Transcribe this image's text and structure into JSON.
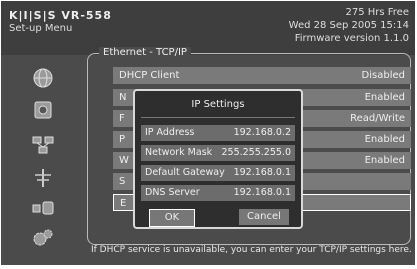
{
  "header": {
    "brand": "K|I|S|S VR-558",
    "subtitle": "Set-up Menu",
    "hours_free": "275 Hrs Free",
    "datetime": "Wed 28 Sep 2005 15:14",
    "firmware": "Firmware version 1.1.0"
  },
  "panel": {
    "title": "Ethernet - TCP/IP",
    "rows": [
      {
        "label": "DHCP Client",
        "value": "Disabled"
      },
      {
        "label": "N",
        "value": "Enabled"
      },
      {
        "label": "F",
        "value": "Read/Write"
      },
      {
        "label": "P",
        "value": "Enabled"
      },
      {
        "label": "W",
        "value": "Enabled"
      },
      {
        "label": "S",
        "value": ""
      },
      {
        "label": "E",
        "value": ""
      }
    ]
  },
  "sidebar": {
    "icons": [
      "globe-icon",
      "disc-icon",
      "network-icon",
      "antenna-icon",
      "settings-icon",
      "gears-icon"
    ]
  },
  "dialog": {
    "title": "IP Settings",
    "rows": [
      {
        "label": "IP Address",
        "value": "192.168.0.2"
      },
      {
        "label": "Network Mask",
        "value": "255.255.255.0"
      },
      {
        "label": "Default Gateway",
        "value": "192.168.0.1"
      },
      {
        "label": "DNS Server",
        "value": "192.168.0.1"
      }
    ],
    "ok_label": "OK",
    "cancel_label": "Cancel"
  },
  "status_text": "If DHCP service is unavailable, you can enter your TCP/IP settings here."
}
